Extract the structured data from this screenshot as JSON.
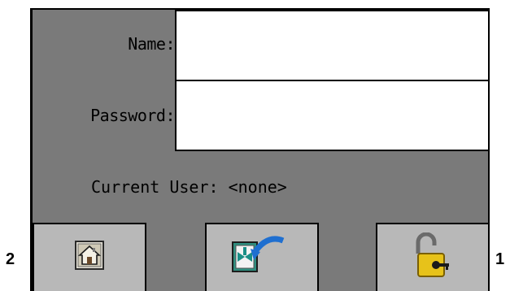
{
  "login": {
    "name_label": "Name:",
    "password_label": "Password:",
    "name_value": "",
    "password_value": "",
    "current_user_text": "Current User: <none>"
  },
  "buttons": [
    {
      "id": "home",
      "icon": "home-icon"
    },
    {
      "id": "flow",
      "icon": "valve-return-icon"
    },
    {
      "id": "lock",
      "icon": "unlock-padlock-icon"
    }
  ],
  "annotations": {
    "left_number": "2",
    "right_number": "1"
  },
  "colors": {
    "panel": "#7a7a7a",
    "button": "#b8b8b8",
    "input": "#ffffff"
  }
}
